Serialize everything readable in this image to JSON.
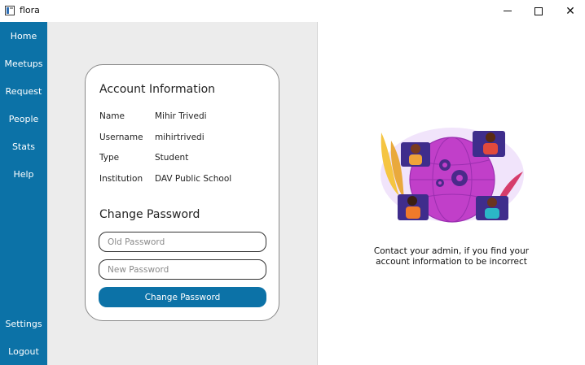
{
  "window": {
    "title": "flora",
    "icons": {
      "app": "app-window-icon",
      "minimize": "minimize-icon",
      "maximize": "maximize-icon",
      "close": "close-icon",
      "close_glyph": "✕"
    }
  },
  "sidebar": {
    "color": "#0c72a7",
    "items": [
      {
        "label": "Home"
      },
      {
        "label": "Meetups"
      },
      {
        "label": "Request"
      },
      {
        "label": "People"
      },
      {
        "label": "Stats"
      },
      {
        "label": "Help"
      }
    ],
    "bottom_items": [
      {
        "label": "Settings"
      },
      {
        "label": "Logout"
      }
    ]
  },
  "account": {
    "title": "Account Information",
    "fields": [
      {
        "label": "Name",
        "value": "Mihir Trivedi"
      },
      {
        "label": "Username",
        "value": "mihirtrivedi"
      },
      {
        "label": "Type",
        "value": "Student"
      },
      {
        "label": "Institution",
        "value": "DAV Public School"
      }
    ]
  },
  "password": {
    "title": "Change Password",
    "old_placeholder": "Old Password",
    "new_placeholder": "New Password",
    "button_label": "Change Password"
  },
  "right": {
    "illustration": "video-meeting-illustration",
    "note_line1": "Contact your admin, if you find your",
    "note_line2": "account information to be incorrect"
  }
}
